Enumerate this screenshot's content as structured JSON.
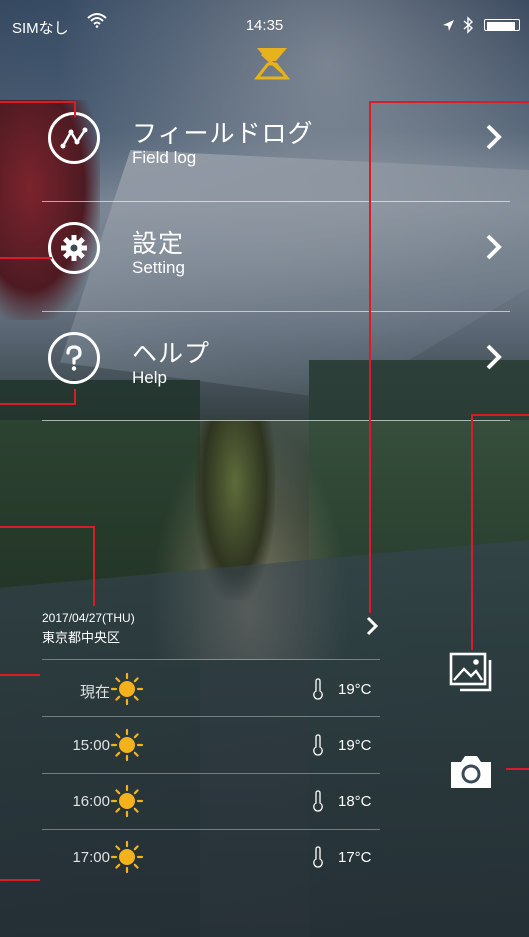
{
  "status_bar": {
    "carrier": "SIMなし",
    "time": "14:35"
  },
  "app": {
    "logo_icon": "app-logo-icon",
    "accent_color": "#d81d28",
    "logo_color": "#e8b21c"
  },
  "menu": {
    "items": [
      {
        "title": "フィールドログ",
        "subtitle": "Field log",
        "icon": "activity-graph-icon"
      },
      {
        "title": "設定",
        "subtitle": "Setting",
        "icon": "gear-icon"
      },
      {
        "title": "ヘルプ",
        "subtitle": "Help",
        "icon": "question-icon"
      }
    ]
  },
  "weather": {
    "date": "2017/04/27(THU)",
    "location": "東京都中央区",
    "rows": [
      {
        "time": "現在",
        "icon": "sun-icon",
        "temp": "19°C"
      },
      {
        "time": "15:00",
        "icon": "sun-icon",
        "temp": "19°C"
      },
      {
        "time": "16:00",
        "icon": "sun-icon",
        "temp": "18°C"
      },
      {
        "time": "17:00",
        "icon": "sun-icon",
        "temp": "17°C"
      }
    ]
  },
  "actions": {
    "gallery_icon": "gallery-icon",
    "camera_icon": "camera-icon"
  }
}
